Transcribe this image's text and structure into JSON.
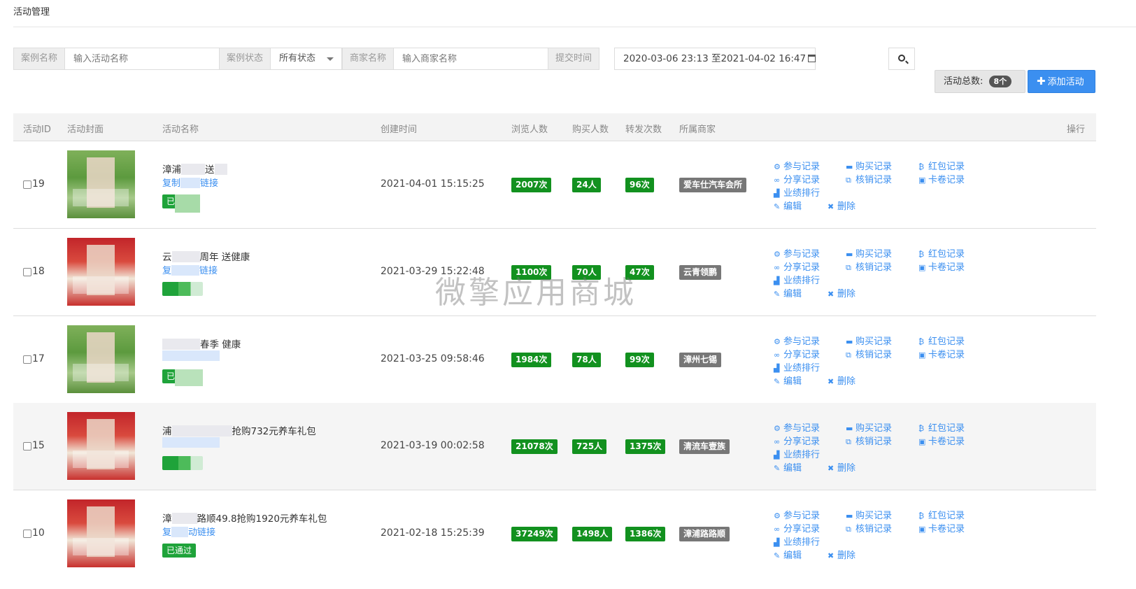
{
  "page": {
    "title": "活动管理"
  },
  "filters": {
    "case_name_label": "案例名称",
    "case_name_placeholder": "输入活动名称",
    "status_label": "案例状态",
    "status_value": "所有状态",
    "merchant_label": "商家名称",
    "merchant_placeholder": "输入商家名称",
    "submit_time_label": "提交时间",
    "date_range": "2020-03-06 23:13 至2021-04-02 16:47"
  },
  "toolbar": {
    "total_label": "活动总数:",
    "total_count": "8个",
    "add_label": "添加活动"
  },
  "table": {
    "headers": {
      "id": "活动ID",
      "cover": "活动封面",
      "name": "活动名称",
      "created": "创建时间",
      "views": "浏览人数",
      "buyers": "购买人数",
      "shares": "转发次数",
      "merchant": "所属商家",
      "ops": "操行"
    },
    "rows": [
      {
        "id": "19",
        "name": "漳浦",
        "name_tail": "送",
        "link": "复制",
        "link_tail": "链接",
        "status": "已",
        "created": "2021-04-01 15:15:25",
        "views": "2007次",
        "buyers": "24人",
        "shares": "96次",
        "merchant": "爱车仕汽车会所"
      },
      {
        "id": "18",
        "name": "云",
        "name_tail": "周年  送健康",
        "link": "复",
        "link_tail": "链接",
        "status": "",
        "created": "2021-03-29 15:22:48",
        "views": "1100次",
        "buyers": "70人",
        "shares": "47次",
        "merchant": "云青领鹏"
      },
      {
        "id": "17",
        "name": "",
        "name_tail": "春季   健康",
        "link": "",
        "link_tail": "",
        "status": "已",
        "created": "2021-03-25 09:58:46",
        "views": "1984次",
        "buyers": "78人",
        "shares": "99次",
        "merchant": "漳州七锡"
      },
      {
        "id": "15",
        "name": "浦",
        "name_tail": "抢购732元养车礼包",
        "link": "",
        "link_tail": "",
        "status": "",
        "created": "2021-03-19 00:02:58",
        "views": "21078次",
        "buyers": "725人",
        "shares": "1375次",
        "merchant": "清流车壹族"
      },
      {
        "id": "10",
        "name": "漳",
        "name_tail": "路顺49.8抢购1920元养车礼包",
        "link": "复",
        "link_tail": "动链接",
        "status": "已通过",
        "created": "2021-02-18 15:25:39",
        "views": "37249次",
        "buyers": "1498人",
        "shares": "1386次",
        "merchant": "漳浦路路顺"
      }
    ],
    "actions": {
      "participate": "参与记录",
      "purchase": "购买记录",
      "redpacket": "红包记录",
      "share": "分享记录",
      "verify": "核销记录",
      "card": "卡卷记录",
      "ranking": "业绩排行",
      "edit": "编辑",
      "delete": "删除"
    }
  },
  "watermark": "微擎应用商城"
}
